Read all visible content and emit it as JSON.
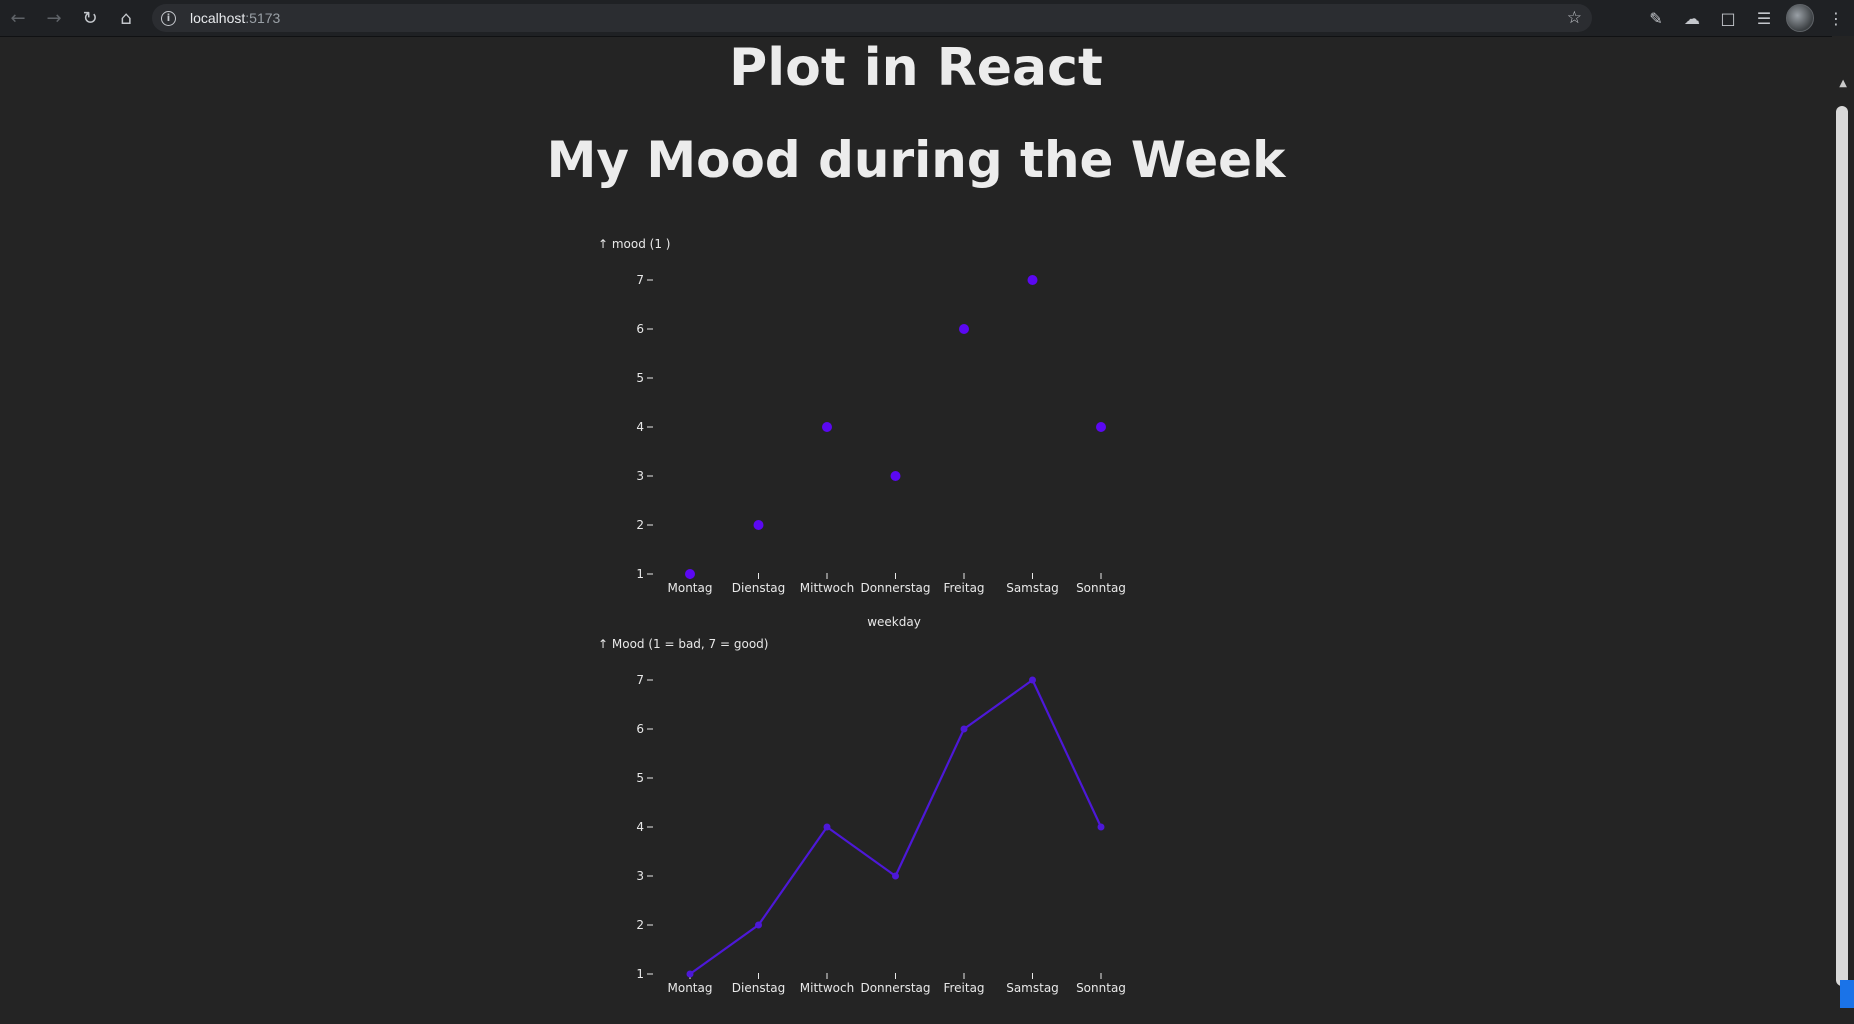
{
  "browser": {
    "url_host": "localhost",
    "url_port": ":5173"
  },
  "page": {
    "title": "Plot in React",
    "chart_heading": "My Mood during the Week"
  },
  "colors": {
    "accent": "#5b08f2",
    "line": "#4d18d8"
  },
  "chart_data": [
    {
      "type": "scatter",
      "categories": [
        "Montag",
        "Dienstag",
        "Mittwoch",
        "Donnerstag",
        "Freitag",
        "Samstag",
        "Sonntag"
      ],
      "values": [
        1,
        2,
        4,
        3,
        6,
        7,
        4
      ],
      "ylabel": "↑ mood (1 )",
      "xlabel": "weekday",
      "yticks": [
        1,
        2,
        3,
        4,
        5,
        6,
        7
      ],
      "ylim": [
        1,
        7
      ],
      "grid": false
    },
    {
      "type": "line",
      "categories": [
        "Montag",
        "Dienstag",
        "Mittwoch",
        "Donnerstag",
        "Freitag",
        "Samstag",
        "Sonntag"
      ],
      "values": [
        1,
        2,
        4,
        3,
        6,
        7,
        4
      ],
      "ylabel": "↑ Mood (1 = bad, 7 = good)",
      "xlabel": "",
      "yticks": [
        1,
        2,
        3,
        4,
        5,
        6,
        7
      ],
      "ylim": [
        1,
        7
      ],
      "grid": false
    }
  ]
}
